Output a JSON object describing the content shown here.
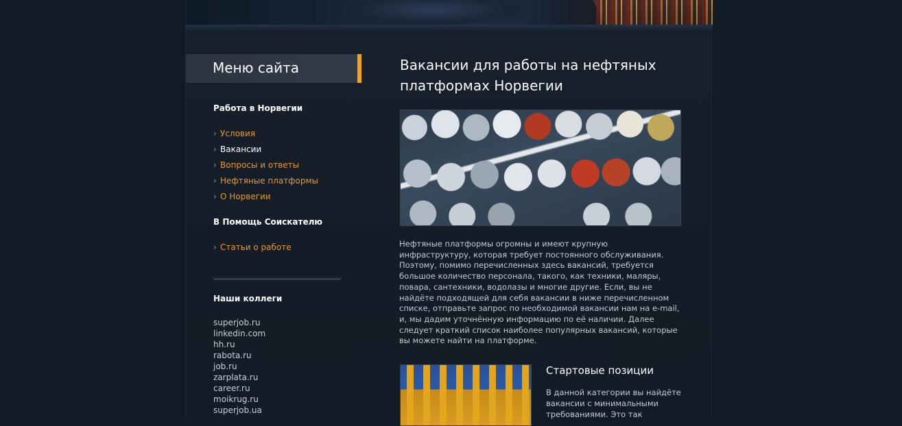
{
  "menu": {
    "title": "Меню сайта",
    "section1_title": "Работа в Норвегии",
    "section1_items": [
      {
        "label": "Условия",
        "current": false
      },
      {
        "label": "Вакансии",
        "current": true
      },
      {
        "label": "Вопросы и ответы",
        "current": false
      },
      {
        "label": "Нефтяные платформы",
        "current": false
      },
      {
        "label": "О Норвегии",
        "current": false
      }
    ],
    "section2_title": "В Помощь Соискателю",
    "section2_items": [
      {
        "label": "Статьи о работе"
      }
    ],
    "colleagues_title": "Наши коллеги",
    "colleagues": [
      "superjob.ru",
      "linkedin.com",
      "hh.ru",
      "rabota.ru",
      "job.ru",
      "zarplata.ru",
      "career.ru",
      "moikrug.ru",
      "superjob.ua"
    ]
  },
  "content": {
    "title": "Вакансии для работы на нефтяных платформах Норвегии",
    "paragraph": "Нефтяные платформы огромны и имеют крупную инфраструктуру, которая требует постоянного обслуживания. Поэтому, помимо перечисленных здесь вакансий, требуется большое количество персонала, такого, как техники, маляры, повара, сантехники, водолазы и многие другие. Если, вы не найдёте подходящей для себя вакансии в ниже перечисленном списке, отправьте запрос по необходимой вакансии нам на e-mail, и, мы дадим уточнённую информацию по её наличии. Далее следует краткий список наиболее популярных вакансий, которые вы можете найти на платформе.",
    "subsection_title": "Стартовые позиции",
    "subsection_text": "В данной категории вы найдёте вакансии с минимальными требованиями. Это так"
  },
  "colors": {
    "accent": "#f6a21a",
    "link": "#e49a34",
    "background": "#111b25"
  }
}
